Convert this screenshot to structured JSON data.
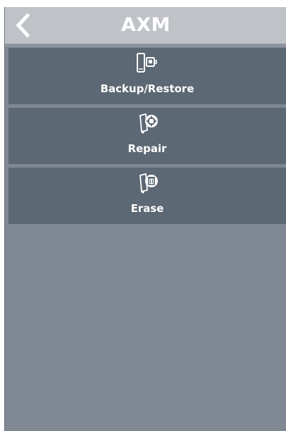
{
  "header": {
    "title": "AXM",
    "back_icon": "chevron-left-icon"
  },
  "menu": {
    "items": [
      {
        "label": "Backup/Restore",
        "icon": "phone-backup-icon"
      },
      {
        "label": "Repair",
        "icon": "phone-repair-icon"
      },
      {
        "label": "Erase",
        "icon": "phone-erase-icon"
      }
    ]
  },
  "colors": {
    "header_bg": "#bfc2c6",
    "menu_item_bg": "#5c6874",
    "background": "#7f8893",
    "text": "#ffffff"
  }
}
